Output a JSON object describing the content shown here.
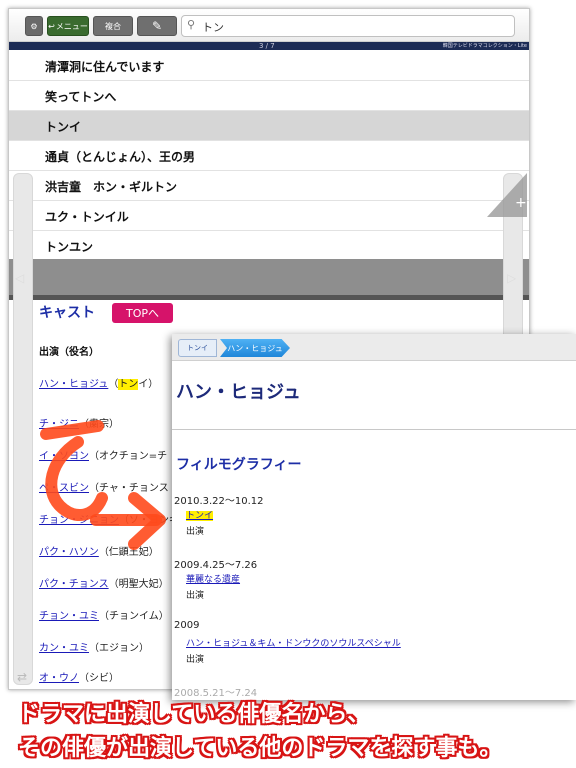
{
  "toolbar": {
    "gear_icon": "gear-icon",
    "menu_label": "メニュー",
    "fukugo_label": "複合",
    "pen_icon": "pen-icon",
    "search_value": "トン"
  },
  "pagebar": {
    "page": "3 / 7",
    "app_name": "韓国テレビドラマコレクション・Lite"
  },
  "results": [
    "清潭洞に住んでいます",
    "笑ってトンへ",
    "トンイ",
    "通貞（とんじょん）、王の男",
    "洪吉童　ホン・ギルトン",
    "ユク・トンイル",
    "トンユン"
  ],
  "selected_result": "トンイ",
  "cast": {
    "title": "キャスト",
    "top_button": "TOPへ",
    "header": "出演（役名）",
    "rows": [
      {
        "name": "ハン・ヒョジュ",
        "role_prefix": "（",
        "role_hl": "トン",
        "role_suffix": "イ）"
      },
      {
        "name": "チ・ジニ",
        "role": "（粛宗）"
      },
      {
        "name": "イ・ソヨン",
        "role": "（オクチョン=チ"
      },
      {
        "name": "ペ・スビン",
        "role": "（チャ・チョンス"
      },
      {
        "name": "チョン・ジニョン",
        "role": "（ソ・ヨンギ"
      },
      {
        "name": "パク・ハソン",
        "role": "（仁顕王妃）"
      },
      {
        "name": "パク・チョンス",
        "role": "（明聖大妃）"
      },
      {
        "name": "チョン・ユミ",
        "role": "（チョンイム）"
      },
      {
        "name": "カン・ユミ",
        "role": "（エジョン）"
      },
      {
        "name": "オ・ウノ",
        "role": "（シビ）"
      }
    ]
  },
  "panel": {
    "crumbs": [
      "トンイ",
      "ハン・ヒョジュ"
    ],
    "title": "ハン・ヒョジュ",
    "filmography_title": "フィルモグラフィー",
    "entries": [
      {
        "date": "2010.3.22〜10.12",
        "work": "トンイ",
        "role": "出演"
      },
      {
        "date": "2009.4.25〜7.26",
        "work": "華麗なる遺産",
        "role": "出演"
      },
      {
        "date": "2009",
        "work": "ハン・ヒョジュ＆キム・ドンウクのソウルスペシャル",
        "role": "出演"
      },
      {
        "date": "2008.5.21〜7.24"
      }
    ]
  },
  "caption": {
    "line1": "ドラマに出演している俳優名から、",
    "line2": "その俳優が出演している他のドラマを探す事も。"
  },
  "colors": {
    "accent_red": "#d81414",
    "top_button": "#d6136a",
    "link": "#1a1ab8",
    "highlight": "#ffee00"
  }
}
